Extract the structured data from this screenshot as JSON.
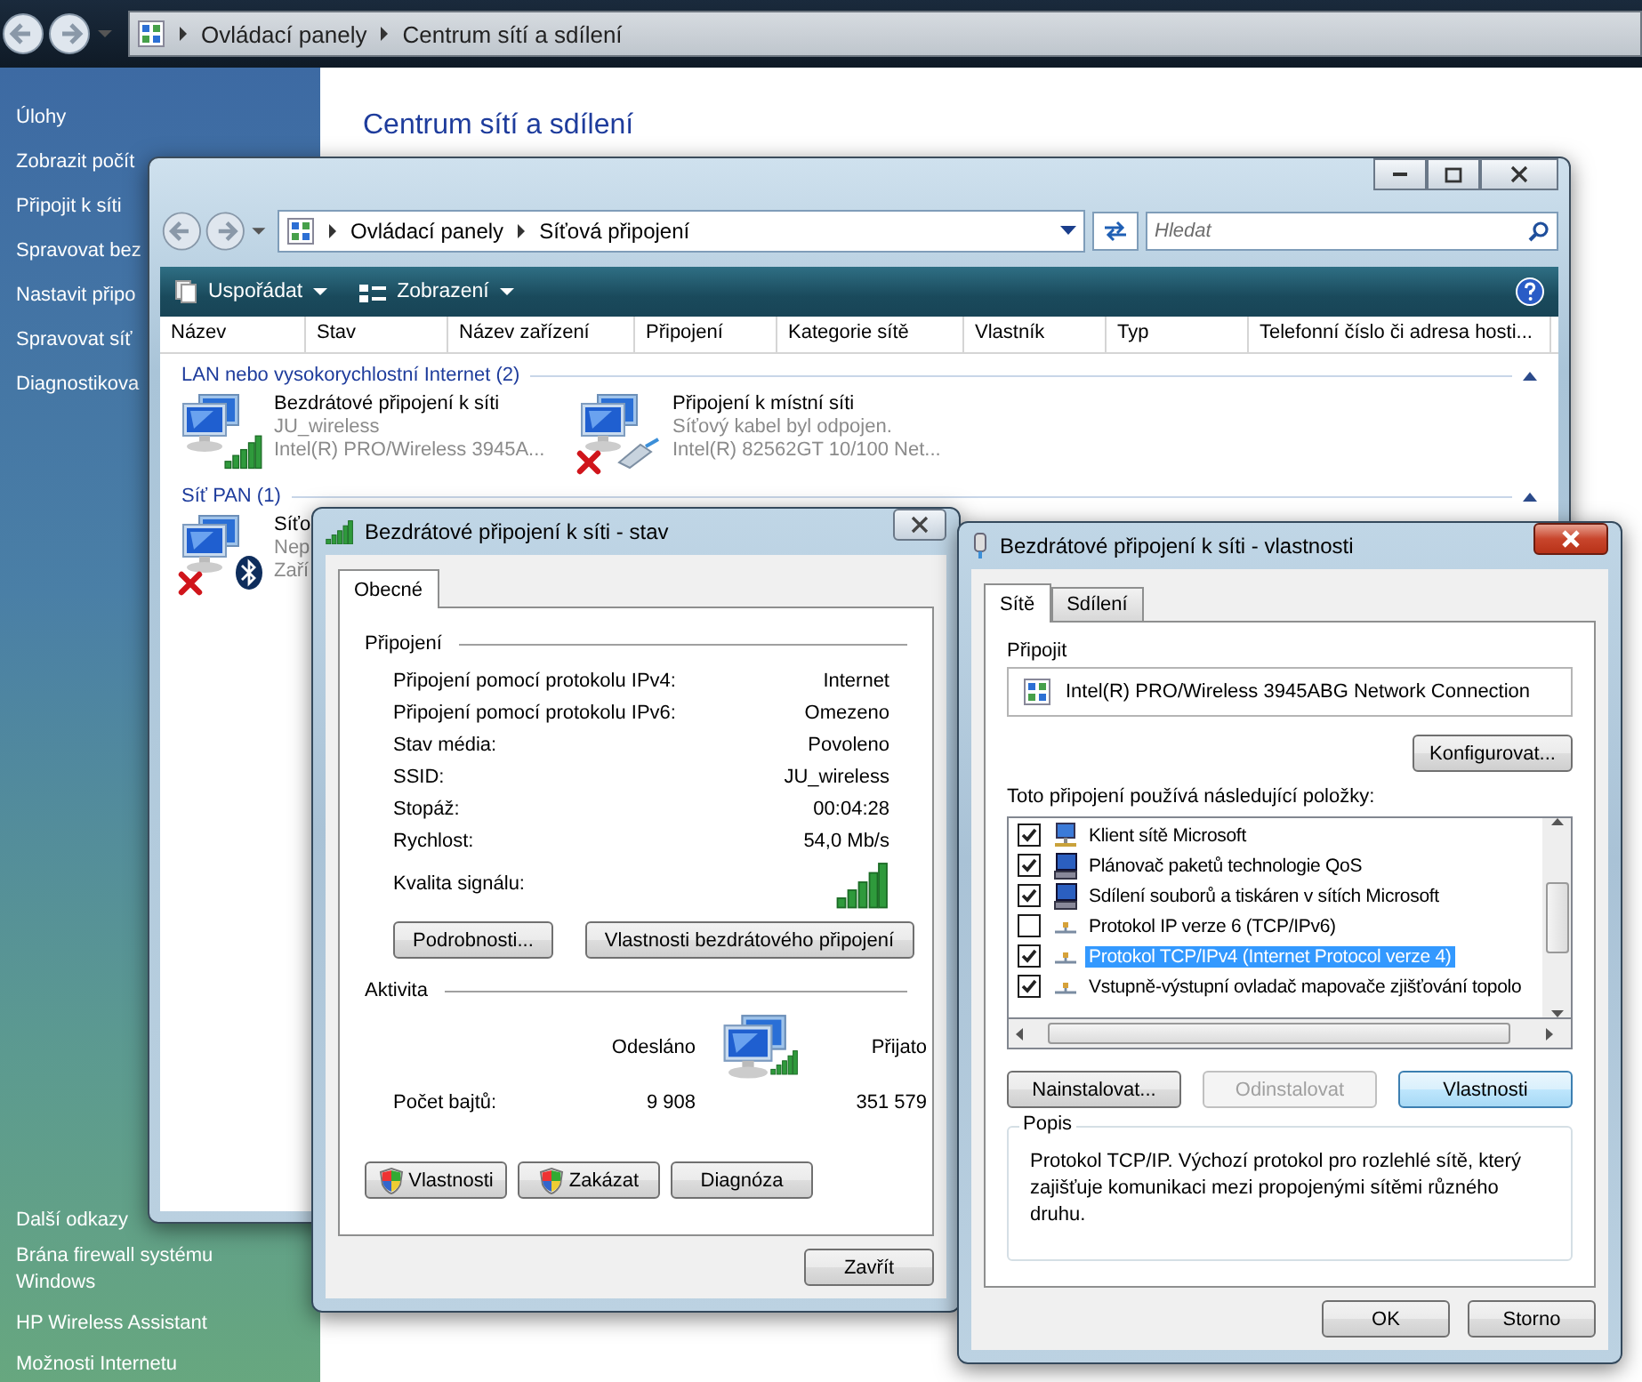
{
  "explorer": {
    "breadcrumb": [
      "Ovládací panely",
      "Centrum sítí a sdílení"
    ]
  },
  "sidebar": {
    "heading": "Úlohy",
    "tasks": [
      "Zobrazit počít",
      "Připojit k síti",
      "Spravovat bez",
      "Nastavit připo",
      "Spravovat síť",
      "Diagnostikova"
    ],
    "see_also_heading": "Další odkazy",
    "links": [
      "Brána firewall systému Windows",
      "HP Wireless Assistant",
      "Možnosti Internetu"
    ]
  },
  "page_title": "Centrum sítí a sdílení",
  "connections_window": {
    "breadcrumb": [
      "Ovládací panely",
      "Síťová připojení"
    ],
    "search_placeholder": "Hledat",
    "toolbar": [
      "Uspořádat",
      "Zobrazení"
    ],
    "columns": [
      "Název",
      "Stav",
      "Název zařízení",
      "Připojení",
      "Kategorie sítě",
      "Vlastník",
      "Typ",
      "Telefonní číslo či adresa hosti..."
    ],
    "groups": [
      {
        "title": "LAN nebo vysokorychlostní Internet (2)",
        "items": [
          {
            "name": "Bezdrátové připojení k síti",
            "status": "JU_wireless",
            "device": "Intel(R) PRO/Wireless 3945A...",
            "kind": "wireless",
            "disconnected": false
          },
          {
            "name": "Připojení k místní síti",
            "status": "Síťový kabel byl odpojen.",
            "device": "Intel(R) 82562GT 10/100 Net...",
            "kind": "ethernet",
            "disconnected": true
          }
        ]
      },
      {
        "title": "Síť PAN (1)",
        "items": [
          {
            "name": "Síťo",
            "status": "Nep",
            "device": "Zaří",
            "kind": "bluetooth",
            "disconnected": true
          }
        ]
      }
    ]
  },
  "status_dialog": {
    "title": "Bezdrátové připojení k síti - stav",
    "tabs": [
      {
        "label": "Obecné",
        "selected": true
      }
    ],
    "connection_heading": "Připojení",
    "rows": [
      {
        "label": "Připojení pomocí protokolu IPv4:",
        "value": "Internet"
      },
      {
        "label": "Připojení pomocí protokolu IPv6:",
        "value": "Omezeno"
      },
      {
        "label": "Stav média:",
        "value": "Povoleno"
      },
      {
        "label": "SSID:",
        "value": "JU_wireless"
      },
      {
        "label": "Stopáž:",
        "value": "00:04:28"
      },
      {
        "label": "Rychlost:",
        "value": "54,0 Mb/s"
      }
    ],
    "signal_label": "Kvalita signálu:",
    "buttons": [
      "Podrobnosti...",
      "Vlastnosti bezdrátového připojení"
    ],
    "activity_heading": "Aktivita",
    "sent_label": "Odesláno",
    "received_label": "Přijato",
    "bytes_label": "Počet bajtů:",
    "sent": "9 908",
    "received": "351 579",
    "action_buttons": [
      {
        "label": "Vlastnosti",
        "shield": true
      },
      {
        "label": "Zakázat",
        "shield": true
      },
      {
        "label": "Diagnóza",
        "shield": false
      }
    ],
    "close_button": "Zavřít"
  },
  "properties_dialog": {
    "title": "Bezdrátové připojení k síti - vlastnosti",
    "tabs": [
      {
        "label": "Sítě",
        "selected": true
      },
      {
        "label": "Sdílení",
        "selected": false
      }
    ],
    "connect_label": "Připojit",
    "adapter": "Intel(R) PRO/Wireless 3945ABG Network Connection",
    "configure_button": "Konfigurovat...",
    "items_label": "Toto připojení používá následující položky:",
    "items": [
      {
        "label": "Klient sítě Microsoft",
        "checked": true,
        "selected": false,
        "kind": "client"
      },
      {
        "label": "Plánovač paketů technologie QoS",
        "checked": true,
        "selected": false,
        "kind": "service"
      },
      {
        "label": "Sdílení souborů a tiskáren v sítích Microsoft",
        "checked": true,
        "selected": false,
        "kind": "service"
      },
      {
        "label": "Protokol IP verze 6 (TCP/IPv6)",
        "checked": false,
        "selected": false,
        "kind": "protocol"
      },
      {
        "label": "Protokol TCP/IPv4 (Internet Protocol verze 4)",
        "checked": true,
        "selected": true,
        "kind": "protocol"
      },
      {
        "label": "Vstupně-výstupní ovladač mapovače zjišťování topolo",
        "checked": true,
        "selected": false,
        "kind": "protocol"
      }
    ],
    "buttons": [
      {
        "label": "Nainstalovat...",
        "disabled": false,
        "default": false
      },
      {
        "label": "Odinstalovat",
        "disabled": true,
        "default": false
      },
      {
        "label": "Vlastnosti",
        "disabled": false,
        "default": true
      }
    ],
    "description_heading": "Popis",
    "description": "Protokol TCP/IP. Výchozí protokol pro rozlehlé sítě, který zajišťuje komunikaci mezi propojenými sítěmi různého druhu.",
    "ok_button": "OK",
    "cancel_button": "Storno"
  }
}
